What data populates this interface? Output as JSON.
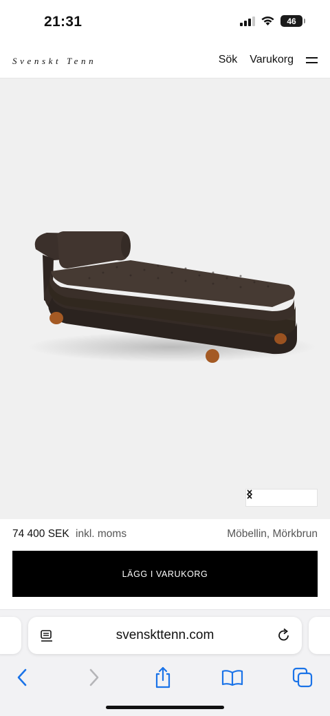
{
  "status_bar": {
    "time": "21:31",
    "battery": "46",
    "icons": [
      "signal-icon",
      "wifi-icon",
      "battery-icon"
    ]
  },
  "header": {
    "brand": "Svenskt Tenn",
    "search_label": "Sök",
    "cart_label": "Varukorg",
    "menu_icon": "hamburger-menu-icon"
  },
  "product": {
    "image_subject": "daybed with bolster cushion",
    "image_bg": "#f0f0f0",
    "upholstery_color": "#3e322c",
    "leg_color": "#a45a24",
    "price": "74 400 SEK",
    "vat_note": "inkl. moms",
    "variant": "Möbellin, Mörkbrun",
    "add_to_cart_label": "LÄGG I VARUKORG"
  },
  "carousel": {
    "prev_icon": "chevron-left-icon",
    "next_icon": "chevron-right-icon"
  },
  "browser": {
    "url": "svenskttenn.com",
    "accent": "#1a73e8",
    "disabled": "#b5b5b8",
    "toolbar_icons": [
      "back-icon",
      "forward-icon",
      "share-icon",
      "bookmarks-icon",
      "tabs-icon"
    ]
  }
}
